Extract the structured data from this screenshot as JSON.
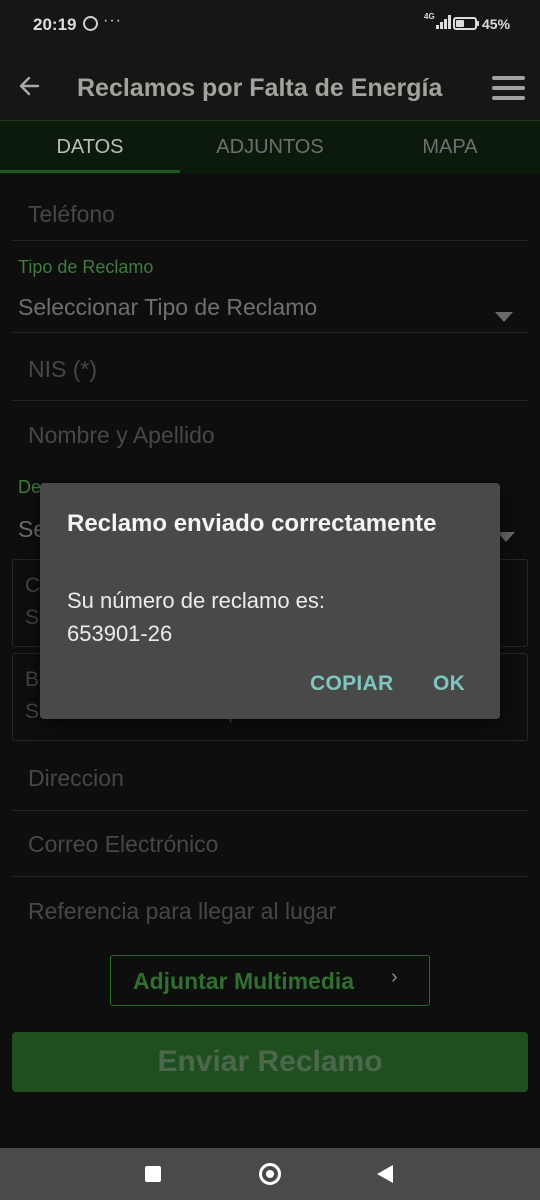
{
  "status_bar": {
    "time": "20:19",
    "more": "···",
    "network": "4G",
    "battery_percent": "45%",
    "battery_level": 0.45
  },
  "app_bar": {
    "title": "Reclamos por Falta de Energía"
  },
  "tabs": [
    {
      "label": "DATOS",
      "active": true
    },
    {
      "label": "ADJUNTOS",
      "active": false
    },
    {
      "label": "MAPA",
      "active": false
    }
  ],
  "form": {
    "telefono_placeholder": "Teléfono",
    "tipo_reclamo_label": "Tipo de Reclamo",
    "tipo_reclamo_value": "Seleccionar Tipo de Reclamo",
    "nis_placeholder": "NIS (*)",
    "nombre_placeholder": "Nombre y Apellido",
    "departamento_label": "De",
    "departamento_value": "Se",
    "ciudad_line1": "C",
    "ciudad_line2": "Se",
    "barrio_line1": "B",
    "barrio_line2": "Seleccione la Ciudad previamente",
    "direccion_placeholder": "Direccion",
    "correo_placeholder": "Correo Electrónico",
    "referencia_placeholder": "Referencia para llegar al lugar",
    "attach_label": "Adjuntar Multimedia",
    "submit_label": "Enviar Reclamo"
  },
  "dialog": {
    "title": "Reclamo enviado correctamente",
    "message_line1": "Su número de reclamo es:",
    "message_line2": "653901-26",
    "copy_label": "COPIAR",
    "ok_label": "OK"
  },
  "colors": {
    "accent": "#2f6f2f",
    "dialog_bg": "#494949",
    "dialog_button": "#7ec7c0"
  }
}
